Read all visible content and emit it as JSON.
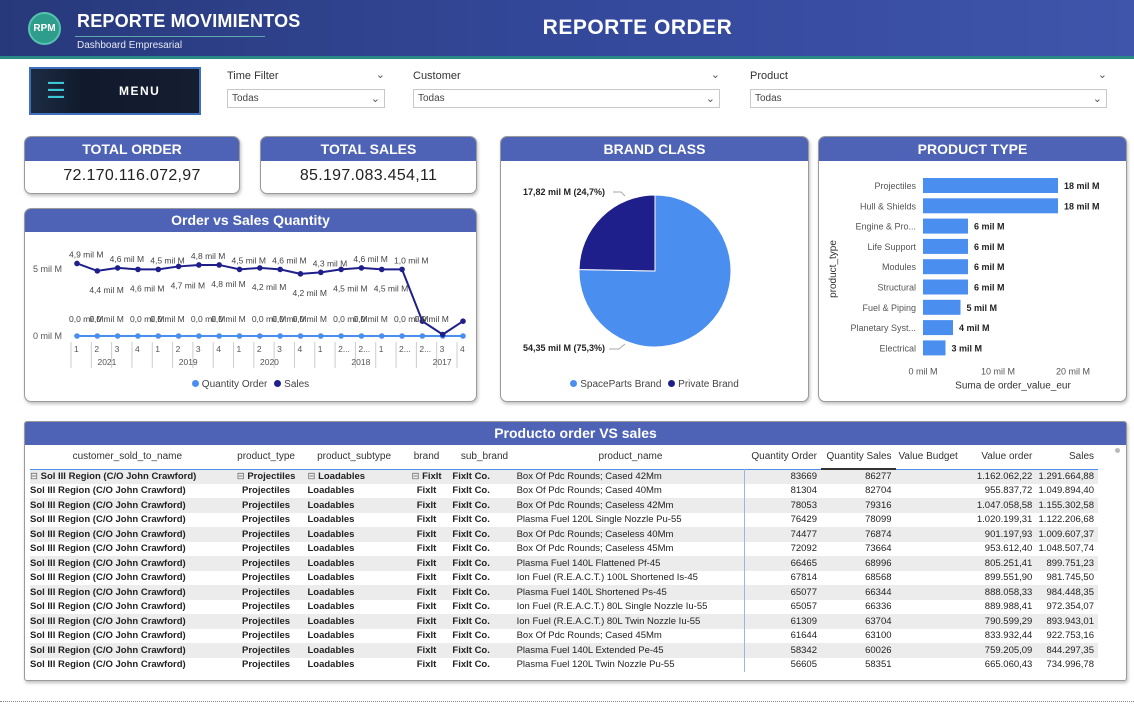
{
  "header": {
    "logo_text": "RPM",
    "app_title": "REPORTE MOVIMIENTOS",
    "app_subtitle": "Dashboard Empresarial",
    "report_title": "REPORTE ORDER"
  },
  "menu": {
    "label": "MENU"
  },
  "filters": [
    {
      "title": "Time Filter",
      "value": "Todas"
    },
    {
      "title": "Customer",
      "value": "Todas"
    },
    {
      "title": "Product",
      "value": "Todas"
    }
  ],
  "kpis": {
    "total_order": {
      "title": "TOTAL ORDER",
      "value": "72.170.116.072,97"
    },
    "total_sales": {
      "title": "TOTAL SALES",
      "value": "85.197.083.454,11"
    }
  },
  "line_chart": {
    "title": "Order vs Sales Quantity",
    "y_ticks": [
      "5 mil M",
      "0 mil M"
    ],
    "legend": [
      "Quantity Order",
      "Sales"
    ],
    "colors": {
      "quantity_order": "#4a8ff0",
      "sales": "#1f1f8c"
    },
    "x_quarters": [
      "1",
      "2",
      "3",
      "4",
      "1",
      "2",
      "3",
      "4",
      "1",
      "2",
      "3",
      "4",
      "1",
      "2...",
      "2...",
      "1",
      "2...",
      "2...",
      "3",
      "4"
    ],
    "x_years": [
      "2021",
      "2019",
      "2020",
      "2018",
      "2017"
    ],
    "sales_labels": [
      "4,9 mil M",
      "4,4 mil M",
      "4,6 mil M",
      "4,6 mil M",
      "4,5 mil M",
      "4,7 mil M",
      "4,8 mil M",
      "4,8 mil M",
      "4,5 mil M",
      "4,2 mil M",
      "4,6 mil M",
      "4,2 mil M",
      "4,3 mil M",
      "4,5 mil M",
      "4,6 mil M",
      "4,5 mil M",
      "1,0 mil M"
    ],
    "order_labels": [
      "0,0 mil M",
      "0,0 mil M",
      "0,0 mil M",
      "0,0 mil M",
      "0,0 mil M",
      "0,0 mil M",
      "0,0 mil M",
      "0,0 mil M",
      "0,0 mil M",
      "0,0 mil M",
      "0,0 mil M",
      "0,0 mil M",
      "0,0 mil M"
    ]
  },
  "chart_data": [
    {
      "type": "line",
      "title": "Order vs Sales Quantity",
      "x": [
        "2021 Q1",
        "2021 Q2",
        "2021 Q3",
        "2021 Q4",
        "2019 Q1",
        "2019 Q2",
        "2019 Q3",
        "2019 Q4",
        "2020 Q1",
        "2020 Q2",
        "2020 Q3",
        "2020 Q4",
        "2018 Q1",
        "2018 Q2",
        "2018 Q3",
        "2018 Q4",
        "2017 Q1",
        "2017 Q2",
        "2017 Q3",
        "2017 Q4"
      ],
      "series": [
        {
          "name": "Quantity Order",
          "values": [
            0,
            0,
            0,
            0,
            0,
            0,
            0,
            0,
            0,
            0,
            0,
            0,
            0,
            0,
            0,
            0,
            0,
            0,
            0,
            0
          ]
        },
        {
          "name": "Sales",
          "values": [
            4.9,
            4.4,
            4.6,
            4.5,
            4.5,
            4.7,
            4.8,
            4.8,
            4.5,
            4.6,
            4.5,
            4.2,
            4.3,
            4.5,
            4.6,
            4.5,
            4.5,
            1.0,
            0.1,
            1.0
          ]
        }
      ],
      "yunit": "mil M",
      "ylim": [
        0,
        5.5
      ]
    },
    {
      "type": "pie",
      "title": "BRAND CLASS",
      "categories": [
        "SpaceParts Brand",
        "Private Brand"
      ],
      "values": [
        54.35,
        17.82
      ],
      "labels": [
        "54,35 mil M (75,3%)",
        "17,82 mil M (24,7%)"
      ],
      "colors": [
        "#4a8ff0",
        "#1f1f8c"
      ]
    },
    {
      "type": "bar",
      "title": "PRODUCT TYPE",
      "orientation": "horizontal",
      "categories": [
        "Projectiles",
        "Hull & Shields",
        "Engine & Pro...",
        "Life Support",
        "Modules",
        "Structural",
        "Fuel & Piping",
        "Planetary Syst...",
        "Electrical"
      ],
      "values": [
        18,
        18,
        6,
        6,
        6,
        6,
        5,
        4,
        3
      ],
      "labels": [
        "18 mil M",
        "18 mil M",
        "6 mil M",
        "6 mil M",
        "6 mil M",
        "6 mil M",
        "5 mil M",
        "4 mil M",
        "3 mil M"
      ],
      "xlabel": "Suma de order_value_eur",
      "ylabel": "product_type",
      "x_ticks": [
        "0 mil M",
        "10 mil M",
        "20 mil M"
      ],
      "xlim": [
        0,
        20
      ],
      "color": "#4a8ff0"
    }
  ],
  "pie": {
    "title": "BRAND CLASS",
    "legend": [
      "SpaceParts Brand",
      "Private Brand"
    ]
  },
  "bar": {
    "title": "PRODUCT TYPE"
  },
  "table": {
    "title": "Producto order VS sales",
    "columns": [
      "customer_sold_to_name",
      "product_type",
      "product_subtype",
      "brand",
      "sub_brand",
      "product_name",
      "Quantity Order",
      "Quantity Sales",
      "Value Budget",
      "Value order",
      "Sales"
    ],
    "rows": [
      [
        "Sol III Region (C/O John Crawford)",
        "Projectiles",
        "Loadables",
        "FixIt",
        "FixIt Co.",
        "Box Of Pdc Rounds; Cased 42Mm",
        "83669",
        "86277",
        "",
        "1.162.062,22",
        "1.291.664,88"
      ],
      [
        "Sol III Region (C/O John Crawford)",
        "Projectiles",
        "Loadables",
        "FixIt",
        "FixIt Co.",
        "Box Of Pdc Rounds; Cased 40Mm",
        "81304",
        "82704",
        "",
        "955.837,72",
        "1.049.894,40"
      ],
      [
        "Sol III Region (C/O John Crawford)",
        "Projectiles",
        "Loadables",
        "FixIt",
        "FixIt Co.",
        "Box Of Pdc Rounds; Caseless 42Mm",
        "78053",
        "79316",
        "",
        "1.047.058,58",
        "1.155.302,58"
      ],
      [
        "Sol III Region (C/O John Crawford)",
        "Projectiles",
        "Loadables",
        "FixIt",
        "FixIt Co.",
        "Plasma Fuel 120L Single Nozzle Pu-55",
        "76429",
        "78099",
        "",
        "1.020.199,31",
        "1.122.206,68"
      ],
      [
        "Sol III Region (C/O John Crawford)",
        "Projectiles",
        "Loadables",
        "FixIt",
        "FixIt Co.",
        "Box Of Pdc Rounds; Caseless 40Mm",
        "74477",
        "76874",
        "",
        "901.197,93",
        "1.009.607,37"
      ],
      [
        "Sol III Region (C/O John Crawford)",
        "Projectiles",
        "Loadables",
        "FixIt",
        "FixIt Co.",
        "Box Of Pdc Rounds; Caseless 45Mm",
        "72092",
        "73664",
        "",
        "953.612,40",
        "1.048.507,74"
      ],
      [
        "Sol III Region (C/O John Crawford)",
        "Projectiles",
        "Loadables",
        "FixIt",
        "FixIt Co.",
        "Plasma Fuel 140L Flattened Pf-45",
        "66465",
        "68996",
        "",
        "805.251,41",
        "899.751,23"
      ],
      [
        "Sol III Region (C/O John Crawford)",
        "Projectiles",
        "Loadables",
        "FixIt",
        "FixIt Co.",
        "Ion Fuel (R.E.A.C.T.) 100L Shortened Is-45",
        "67814",
        "68568",
        "",
        "899.551,90",
        "981.745,50"
      ],
      [
        "Sol III Region (C/O John Crawford)",
        "Projectiles",
        "Loadables",
        "FixIt",
        "FixIt Co.",
        "Plasma Fuel 140L Shortened Ps-45",
        "65077",
        "66344",
        "",
        "888.058,33",
        "984.448,35"
      ],
      [
        "Sol III Region (C/O John Crawford)",
        "Projectiles",
        "Loadables",
        "FixIt",
        "FixIt Co.",
        "Ion Fuel (R.E.A.C.T.) 80L Single Nozzle Iu-55",
        "65057",
        "66336",
        "",
        "889.988,41",
        "972.354,07"
      ],
      [
        "Sol III Region (C/O John Crawford)",
        "Projectiles",
        "Loadables",
        "FixIt",
        "FixIt Co.",
        "Ion Fuel (R.E.A.C.T.) 80L Twin Nozzle Iu-55",
        "61309",
        "63704",
        "",
        "790.599,29",
        "893.943,01"
      ],
      [
        "Sol III Region (C/O John Crawford)",
        "Projectiles",
        "Loadables",
        "FixIt",
        "FixIt Co.",
        "Box Of Pdc Rounds; Cased 45Mm",
        "61644",
        "63100",
        "",
        "833.932,44",
        "922.753,16"
      ],
      [
        "Sol III Region (C/O John Crawford)",
        "Projectiles",
        "Loadables",
        "FixIt",
        "FixIt Co.",
        "Plasma Fuel 140L Extended Pe-45",
        "58342",
        "60026",
        "",
        "759.205,09",
        "844.297,35"
      ],
      [
        "Sol III Region (C/O John Crawford)",
        "Projectiles",
        "Loadables",
        "FixIt",
        "FixIt Co.",
        "Plasma Fuel 120L Twin Nozzle Pu-55",
        "56605",
        "58351",
        "",
        "665.060,43",
        "734.996,78"
      ]
    ]
  }
}
